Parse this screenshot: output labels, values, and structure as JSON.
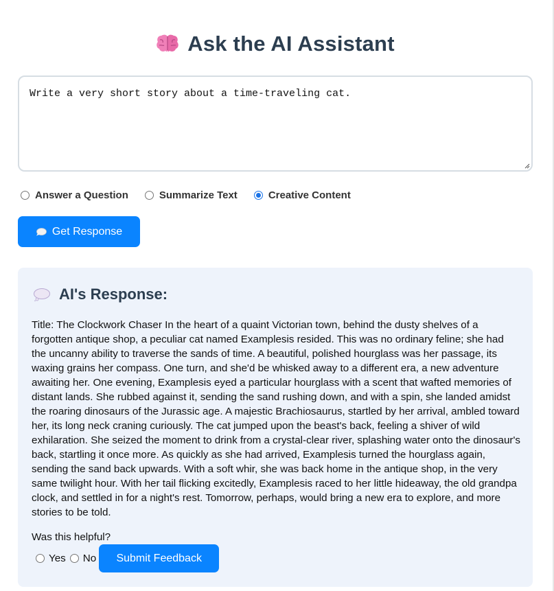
{
  "header": {
    "title": "Ask the AI Assistant",
    "icon": "brain-icon"
  },
  "prompt": {
    "value": "Write a very short story about a time-traveling cat."
  },
  "modes": [
    {
      "label": "Answer a Question",
      "checked": false
    },
    {
      "label": "Summarize Text",
      "checked": false
    },
    {
      "label": "Creative Content",
      "checked": true
    }
  ],
  "actions": {
    "get_response_label": "Get Response",
    "get_response_icon": "speech-bubble-icon"
  },
  "response": {
    "heading": "AI's Response:",
    "heading_icon": "thought-bubble-icon",
    "text": "Title: The Clockwork Chaser In the heart of a quaint Victorian town, behind the dusty shelves of a forgotten antique shop, a peculiar cat named Examplesis resided. This was no ordinary feline; she had the uncanny ability to traverse the sands of time. A beautiful, polished hourglass was her passage, its waxing grains her compass. One turn, and she'd be whisked away to a different era, a new adventure awaiting her. One evening, Examplesis eyed a particular hourglass with a scent that wafted memories of distant lands. She rubbed against it, sending the sand rushing down, and with a spin, she landed amidst the roaring dinosaurs of the Jurassic age. A majestic Brachiosaurus, startled by her arrival, ambled toward her, its long neck craning curiously. The cat jumped upon the beast's back, feeling a shiver of wild exhilaration. She seized the moment to drink from a crystal-clear river, splashing water onto the dinosaur's back, startling it once more. As quickly as she had arrived, Examplesis turned the hourglass again, sending the sand back upwards. With a soft whir, she was back home in the antique shop, in the very same twilight hour. With her tail flicking excitedly, Examplesis raced to her little hideaway, the old grandpa clock, and settled in for a night's rest. Tomorrow, perhaps, would bring a new era to explore, and more stories to be told."
  },
  "feedback": {
    "question": "Was this helpful?",
    "yes_label": "Yes",
    "no_label": "No",
    "submit_label": "Submit Feedback"
  },
  "colors": {
    "accent": "#0a84ff",
    "panel_bg": "#eef3fb",
    "heading": "#2c3e50"
  }
}
